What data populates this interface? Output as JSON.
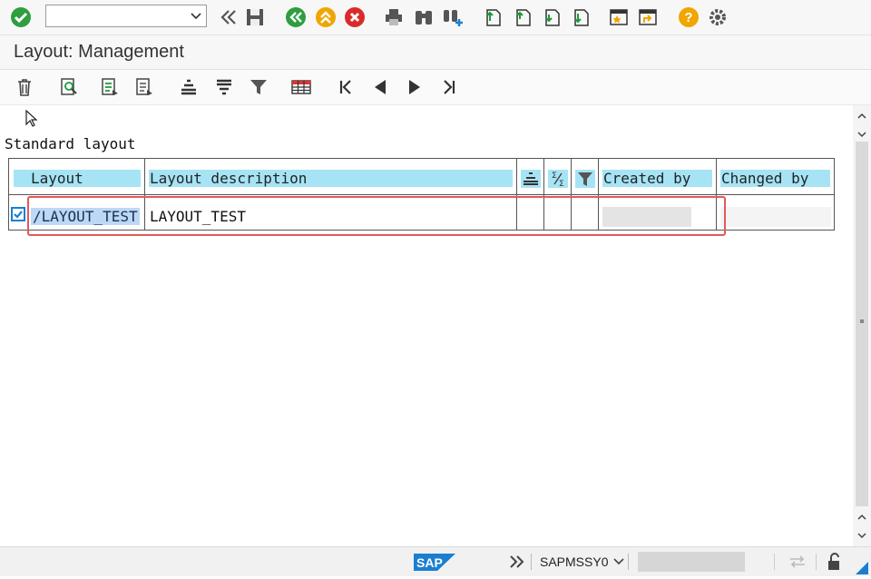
{
  "command_field": {
    "value": ""
  },
  "title": "Layout: Management",
  "section_title": "Standard layout",
  "grid": {
    "headers": {
      "layout": "Layout",
      "description": "Layout description",
      "created_by": "Created by",
      "changed_by": "Changed by"
    },
    "rows": [
      {
        "checked": true,
        "layout": "/LAYOUT_TEST",
        "description": "LAYOUT_TEST",
        "created_by": "",
        "changed_by": ""
      }
    ]
  },
  "status": {
    "system": "SAPMSSY0",
    "brand": "SAP"
  },
  "colors": {
    "accent": "#1a7fd1",
    "header_cell": "#a6e4f5",
    "highlight": "#e05a5a"
  }
}
